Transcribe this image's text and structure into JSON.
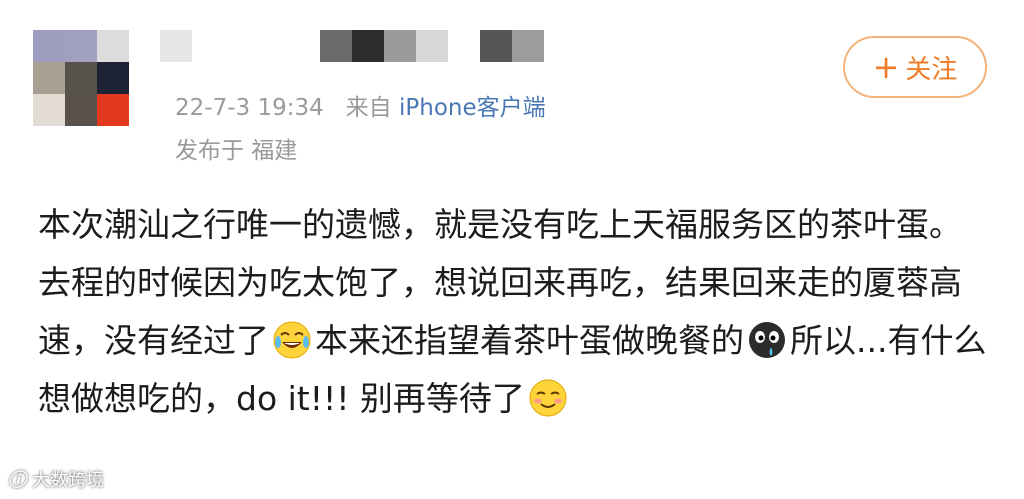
{
  "post": {
    "date": "22-7-3 19:34",
    "from_prefix": "来自",
    "source": "iPhone客户端",
    "location": "发布于 福建",
    "follow_label": "关注",
    "text_part1": "本次潮汕之行唯一的遗憾，就是没有吃上天福服务区的茶叶蛋。去程的时候因为吃太饱了，想说回来再吃，结果回来走的厦蓉高速，没有经过了",
    "text_part2": "本来还指望着茶叶蛋做晚餐的",
    "text_part3": "所以...有什么想做想吃的，do it!!! 别再等待了",
    "emojis": [
      "laugh-crying-emoji",
      "sweating-dark-face-emoji",
      "smug-smile-emoji"
    ]
  },
  "avatar": {
    "pixel_colors": [
      "#9e9cbf",
      "#a2a0c0",
      "#dcdcdc",
      "#a89f93",
      "#57514b",
      "#1d2335",
      "#e1dbd3",
      "#5a524a",
      "#e33a1f"
    ]
  },
  "name_mosaic": {
    "pixel_colors": [
      "#e6e6e6",
      "#ffffff",
      "#ffffff",
      "#ffffff",
      "#ffffff",
      "#6a6a6a",
      "#2d2d2d",
      "#9a9a9a",
      "#d8d8d8",
      "#ffffff",
      "#555555",
      "#9c9c9c"
    ]
  },
  "watermark": {
    "logo": "ⓘ",
    "text": "大数跨境"
  },
  "colors": {
    "accent_orange": "#f07b24",
    "link_blue": "#4a78b5",
    "meta_gray": "#9a9a9a"
  }
}
